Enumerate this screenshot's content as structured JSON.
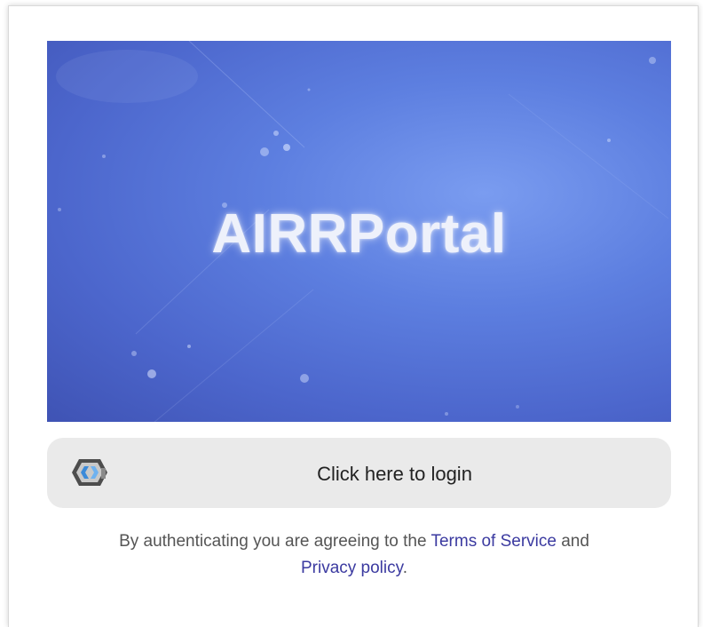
{
  "hero": {
    "title": "AIRRPortal"
  },
  "login": {
    "label": "Click here to login",
    "icon": "keycloak-logo-icon"
  },
  "legal": {
    "prefix": "By authenticating you are agreeing to the ",
    "terms_link": "Terms of Service",
    "middle": " and",
    "privacy_link": "Privacy policy",
    "suffix": "."
  },
  "colors": {
    "hero_gradient": [
      "#7a9cf0",
      "#5d7fe0",
      "#4c66cc",
      "#3f53b4"
    ],
    "link": "#3b3aa0",
    "button_bg": "#eaeaea",
    "text": "#555555"
  }
}
